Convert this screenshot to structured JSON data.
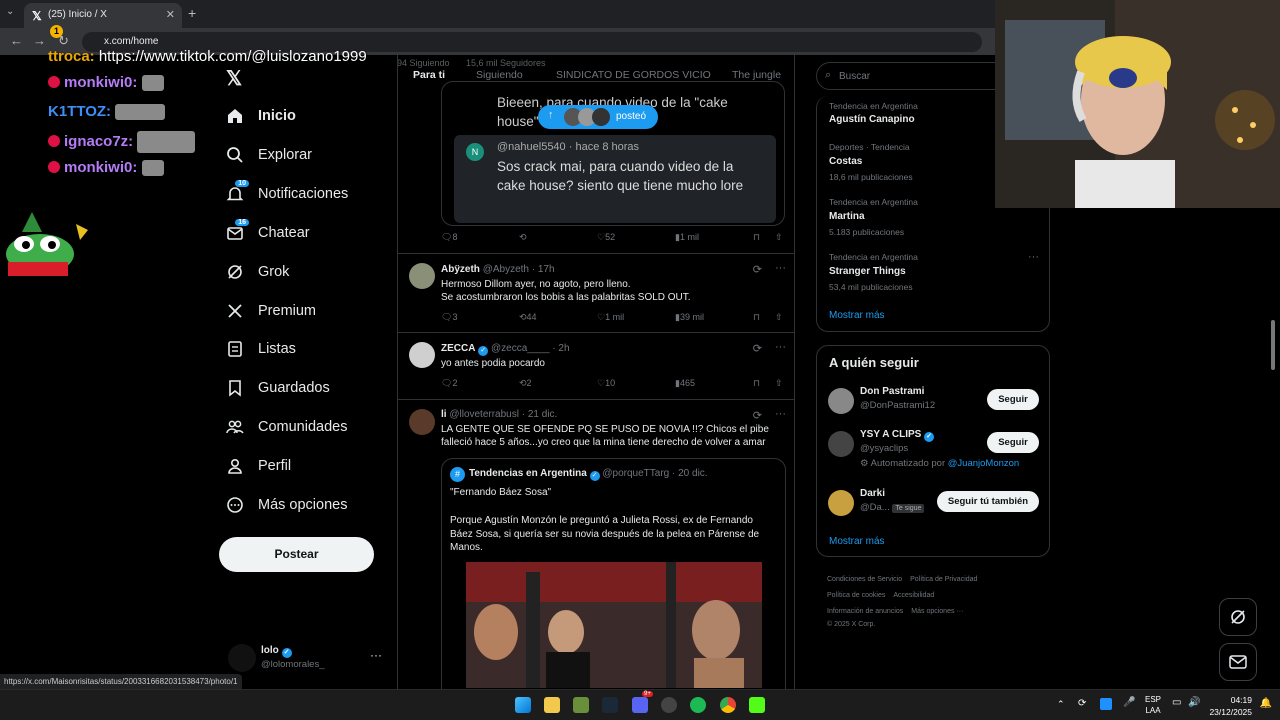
{
  "browser": {
    "tab_title": "(25) Inicio / X",
    "url": "x.com/home",
    "notification_badge": "1",
    "status_url": "https://x.com/Maisonrisitas/status/2003316682031538473/photo/1"
  },
  "chat": {
    "lines": [
      {
        "user": "ttroca:",
        "message": "https://www.tiktok.com/@luislozano1999",
        "color": "#e8a800"
      },
      {
        "user": "monkiwi0:",
        "message": "",
        "color": "#b57cf7"
      },
      {
        "user": "K1TTOZ:",
        "message": "",
        "color": "#3e8ef7"
      },
      {
        "user": "ignaco7z:",
        "message": "",
        "color": "#b57cf7"
      },
      {
        "user": "monkiwi0:",
        "message": "",
        "color": "#b57cf7"
      }
    ]
  },
  "sidebar": {
    "items": [
      {
        "label": "Inicio",
        "icon": "home-icon",
        "badge": ""
      },
      {
        "label": "Explorar",
        "icon": "search-icon",
        "badge": ""
      },
      {
        "label": "Notificaciones",
        "icon": "bell-icon",
        "badge": "10"
      },
      {
        "label": "Chatear",
        "icon": "mail-icon",
        "badge": "16"
      },
      {
        "label": "Grok",
        "icon": "grok-icon",
        "badge": ""
      },
      {
        "label": "Premium",
        "icon": "x-icon",
        "badge": ""
      },
      {
        "label": "Listas",
        "icon": "list-icon",
        "badge": ""
      },
      {
        "label": "Guardados",
        "icon": "bookmark-icon",
        "badge": ""
      },
      {
        "label": "Comunidades",
        "icon": "people-icon",
        "badge": ""
      },
      {
        "label": "Perfil",
        "icon": "person-icon",
        "badge": ""
      },
      {
        "label": "Más opciones",
        "icon": "more-circle-icon",
        "badge": ""
      }
    ],
    "post_label": "Postear",
    "account": {
      "name": "lolo",
      "handle": "@lolomorales_"
    }
  },
  "feed": {
    "tabs": [
      "Para ti",
      "Siguiendo",
      "SINDICATO DE GORDOS VICIO",
      "The jungle"
    ],
    "ghost_counts": {
      "following": "694 Siguiendo",
      "followers": "15,6 mil Seguidores"
    },
    "new_posts_pill": "posteó",
    "quoted_partial_text": "Bieeen, para cuando video de la \"cake house\"",
    "quoted_reply": {
      "handle": "@nahuel5540",
      "time": "· hace 8 horas",
      "avatar_letter": "N",
      "text": "Sos crack mai, para cuando video de la cake house? siento que tiene mucho lore"
    },
    "first_actions": {
      "replies": "8",
      "likes": "52",
      "views": "1 mil"
    },
    "tweets": [
      {
        "name": "Abÿzeth",
        "handle": "@Abyzeth",
        "time": "· 17h",
        "verified": false,
        "text": [
          "Hermoso Dillom ayer, no agoto, pero lleno.",
          "Se acostumbraron los bobis a las palabritas SOLD OUT."
        ],
        "replies": "3",
        "retweets": "44",
        "likes": "1 mil",
        "views": "39 mil"
      },
      {
        "name": "ZECCA",
        "handle": "@zecca____",
        "time": "· 2h",
        "verified": true,
        "text": [
          "yo antes podia pocardo"
        ],
        "replies": "2",
        "retweets": "2",
        "likes": "10",
        "views": "465"
      },
      {
        "name": "li",
        "handle": "@lloveterrabusl",
        "time": "· 21 dic.",
        "verified": false,
        "text": [
          "LA GENTE QUE SE OFENDE PQ SE PUSO DE NOVIA !!? Chicos el pibe",
          "falleció hace 5 años...yo creo que la mina tiene derecho de volver a amar"
        ]
      }
    ],
    "quote": {
      "name": "Tendencias en Argentina",
      "handle": "@porqueTTarg",
      "time": "· 20 dic.",
      "line1": "\"Fernando Báez Sosa\"",
      "body": [
        "Porque Agustín Monzón le preguntó a Julieta Rossi, ex de Fernando",
        "Báez Sosa, si quería ser su novia después de la pelea en Párense de",
        "Manos."
      ]
    }
  },
  "right": {
    "search_placeholder": "Buscar",
    "trends": [
      {
        "category": "Tendencia en Argentina",
        "name": "Agustín Canapino",
        "count": ""
      },
      {
        "category": "Deportes · Tendencia",
        "name": "Costas",
        "count": "18,6 mil publicaciones"
      },
      {
        "category": "Tendencia en Argentina",
        "name": "Martina",
        "count": "5.183 publicaciones"
      },
      {
        "category": "Tendencia en Argentina",
        "name": "Stranger Things",
        "count": "53,4 mil publicaciones"
      }
    ],
    "show_more": "Mostrar más",
    "follow_title": "A quién seguir",
    "follow": [
      {
        "name": "Don Pastrami",
        "handle": "@DonPastrami12",
        "button": "Seguir",
        "extra": "",
        "extra_link": "",
        "follows_you": ""
      },
      {
        "name": "YSY A CLIPS",
        "handle": "@ysyaclips",
        "button": "Seguir",
        "extra": "Automatizado por",
        "extra_link": "@JuanjoMonzon",
        "follows_you": ""
      },
      {
        "name": "Darki",
        "handle": "@Da...",
        "button": "Seguir tú también",
        "extra": "",
        "extra_link": "",
        "follows_you": "Te sigue"
      }
    ],
    "follow_more": "Mostrar más",
    "footer": [
      "Condiciones de Servicio",
      "Política de Privacidad",
      "Política de cookies",
      "Accesibilidad",
      "Información de anuncios",
      "Más opciones ···",
      "© 2025 X Corp."
    ]
  },
  "taskbar": {
    "lang": "ESP",
    "lang2": "LAA",
    "time": "04:19",
    "date": "23/12/2025",
    "badge": "9+"
  }
}
